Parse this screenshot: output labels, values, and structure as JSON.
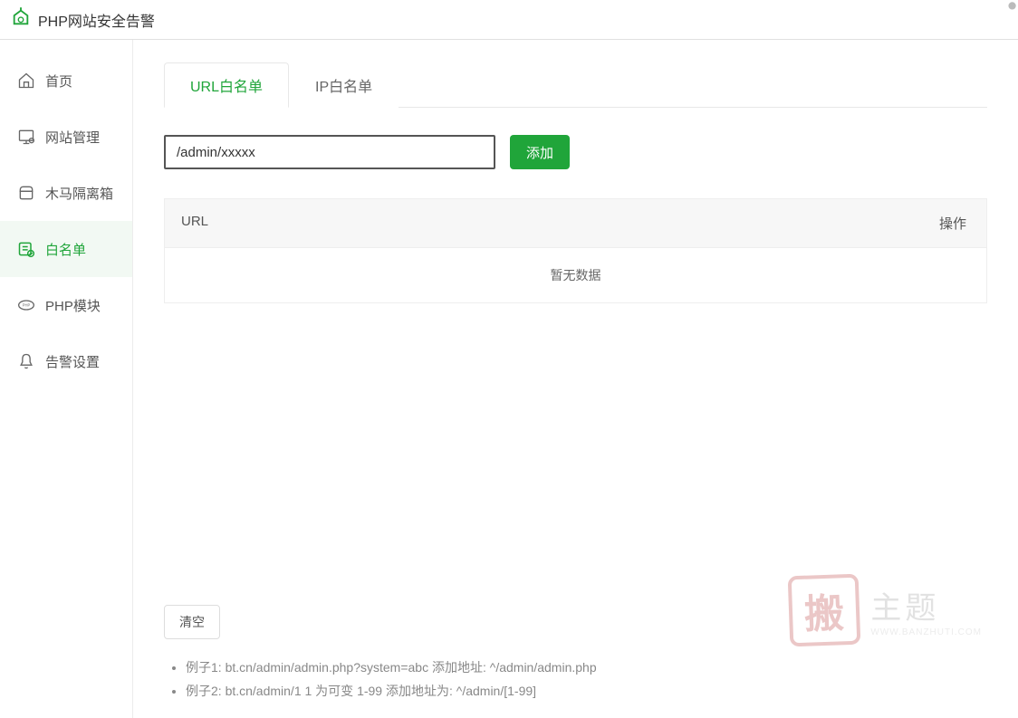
{
  "header": {
    "title": "PHP网站安全告警"
  },
  "sidebar": {
    "items": [
      {
        "label": "首页"
      },
      {
        "label": "网站管理"
      },
      {
        "label": "木马隔离箱"
      },
      {
        "label": "白名单"
      },
      {
        "label": "PHP模块"
      },
      {
        "label": "告警设置"
      }
    ]
  },
  "tabs": [
    {
      "label": "URL白名单"
    },
    {
      "label": "IP白名单"
    }
  ],
  "input": {
    "value": "/admin/xxxxx",
    "add_label": "添加"
  },
  "table": {
    "columns": {
      "url": "URL",
      "action": "操作"
    },
    "empty_text": "暂无数据"
  },
  "footer": {
    "clear_label": "清空",
    "hints": [
      "例子1: bt.cn/admin/admin.php?system=abc 添加地址: ^/admin/admin.php",
      "例子2: bt.cn/admin/1 1 为可变 1-99 添加地址为: ^/admin/[1-99]"
    ]
  },
  "watermark": {
    "stamp": "搬",
    "title": "主题",
    "url": "WWW.BANZHUTI.COM"
  },
  "colors": {
    "accent": "#20a53a"
  }
}
